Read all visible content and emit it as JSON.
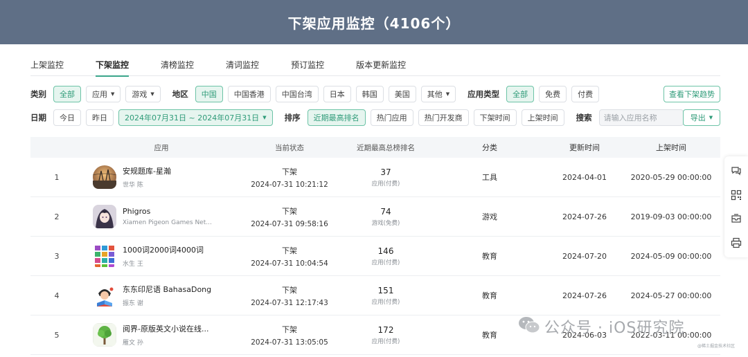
{
  "header": {
    "title": "下架应用监控（4106个）"
  },
  "tabs": [
    {
      "label": "上架监控",
      "active": false
    },
    {
      "label": "下架监控",
      "active": true
    },
    {
      "label": "清榜监控",
      "active": false
    },
    {
      "label": "清词监控",
      "active": false
    },
    {
      "label": "预订监控",
      "active": false
    },
    {
      "label": "版本更新监控",
      "active": false
    }
  ],
  "filters": {
    "category_label": "类别",
    "category_all": "全部",
    "category_app": "应用",
    "category_game": "游戏",
    "region_label": "地区",
    "regions": [
      "中国",
      "中国香港",
      "中国台湾",
      "日本",
      "韩国",
      "美国"
    ],
    "region_other": "其他",
    "app_type_label": "应用类型",
    "app_types": [
      "全部",
      "免费",
      "付费"
    ],
    "trend_button": "查看下架趋势",
    "date_label": "日期",
    "today": "今日",
    "yesterday": "昨日",
    "date_range": "2024年07月31日 ~ 2024年07月31日",
    "sort_label": "排序",
    "sorts": [
      "近期最高排名",
      "热门应用",
      "热门开发商",
      "下架时间",
      "上架时间"
    ],
    "search_label": "搜索",
    "search_placeholder": "请输入应用名称",
    "export_button": "导出"
  },
  "table": {
    "columns": [
      "应用",
      "当前状态",
      "近期最高总榜排名",
      "分类",
      "更新时间",
      "上架时间"
    ],
    "rows": [
      {
        "index": "1",
        "name": "安规题库-星瀚",
        "developer": "世华 陈",
        "status": "下架",
        "status_time": "2024-07-31 10:21:12",
        "rank": "37",
        "rank_type": "应用(付费)",
        "category": "工具",
        "updated": "2024-04-01",
        "listed": "2020-05-29 00:00:00",
        "icon": "globe-tower-icon"
      },
      {
        "index": "2",
        "name": "Phigros",
        "developer": "Xiamen Pigeon Games Net...",
        "status": "下架",
        "status_time": "2024-07-31 09:58:16",
        "rank": "74",
        "rank_type": "游戏(免费)",
        "category": "游戏",
        "updated": "2024-07-26",
        "listed": "2019-09-03 00:00:00",
        "icon": "anime-character-icon"
      },
      {
        "index": "3",
        "name": "1000词2000词4000词",
        "developer": "水生 王",
        "status": "下架",
        "status_time": "2024-07-31 10:04:54",
        "rank": "146",
        "rank_type": "应用(付费)",
        "category": "教育",
        "updated": "2024-07-20",
        "listed": "2024-05-09 00:00:00",
        "icon": "color-grid-icon"
      },
      {
        "index": "4",
        "name": "东东印尼语 BahasaDong",
        "developer": "振东 谢",
        "status": "下架",
        "status_time": "2024-07-31 12:17:43",
        "rank": "151",
        "rank_type": "应用(付费)",
        "category": "教育",
        "updated": "2024-07-26",
        "listed": "2024-05-27 00:00:00",
        "icon": "reading-girl-icon"
      },
      {
        "index": "5",
        "name": "阅界-原版英文小说在线...",
        "developer": "雁文 孙",
        "status": "下架",
        "status_time": "2024-07-31 13:05:05",
        "rank": "172",
        "rank_type": "应用(付费)",
        "category": "教育",
        "updated": "2024-06-03",
        "listed": "2022-03-11 00:00:00",
        "icon": "green-tree-icon"
      }
    ]
  },
  "sidebar": [
    "chat-icon",
    "qrcode-icon",
    "mail-icon",
    "print-icon"
  ],
  "watermark": {
    "text": "公众号 · iOS研究院",
    "small": "@稀土掘金技术社区"
  },
  "colors": {
    "header_bg": "#5f6f86",
    "accent": "#3aa58a",
    "chip_active_bg": "#e6f5ef"
  }
}
